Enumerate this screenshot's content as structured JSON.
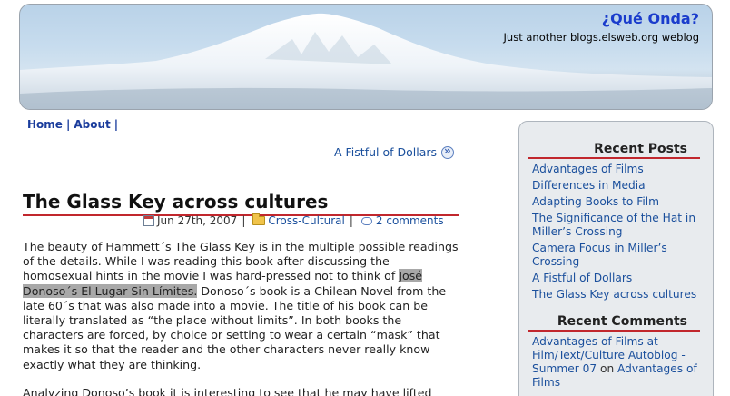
{
  "header": {
    "title": "¿Qué Onda?",
    "tagline": "Just another blogs.elsweb.org weblog"
  },
  "nav": {
    "items": [
      "Home",
      "About"
    ],
    "separator": "|"
  },
  "post_nav": {
    "prev_label": "A Fistful of Dollars",
    "icon": "circle-double-arrow-icon"
  },
  "post": {
    "title": "The Glass Key across cultures",
    "date": "Jun 27th, 2007",
    "category": "Cross-Cultural",
    "comments": "2 comments",
    "p1_a": "The beauty of Hammett´s ",
    "p1_book": "The Glass Key",
    "p1_b": " is in the multiple possible readings of the details. While I was reading this book after discussing the homosexual hints in the movie I was hard-pressed not to think of ",
    "p1_highlight": "José Donoso´s El Lugar Sin Límites.",
    "p1_c": " Donoso´s book is a Chilean Novel from the late 60´s that was also made into a movie. The title of his book can be literally translated as “the place without limits”. In both books the characters are forced, by choice or setting to wear a certain “mask” that makes it so that the reader and the other characters never really know exactly what they are thinking.",
    "p2": "Analyzing Donoso’s book it is interesting to see that he may have lifted"
  },
  "sidebar": {
    "recent_posts_title": "Recent Posts",
    "recent_posts": [
      "Advantages of Films",
      "Differences in Media",
      "Adapting Books to Film",
      "The Significance of the Hat in Miller’s Crossing",
      "Camera Focus in Miller’s Crossing",
      "A Fistful of Dollars",
      "The Glass Key across cultures"
    ],
    "recent_comments_title": "Recent Comments",
    "comment1_author": "Advantages of Films at Film/Text/Culture Autoblog -Summer 07",
    "comment1_on": "on",
    "comment1_post": "Advantages of Films"
  },
  "colors": {
    "link": "#1a4f9c",
    "title_blue": "#1a3ccc",
    "rule_red": "#c1272d",
    "sidebar_bg": "#e8ebee"
  }
}
